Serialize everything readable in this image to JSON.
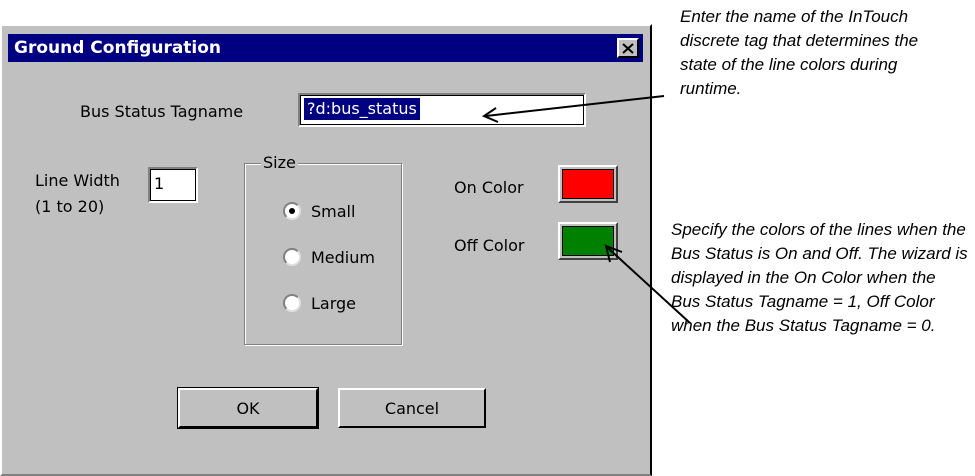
{
  "dialog": {
    "title": "Ground Configuration",
    "close_icon": "close-icon",
    "bus_status_label": "Bus Status Tagname",
    "bus_status_value": "?d:bus_status",
    "line_width_label": "Line Width",
    "line_width_range": "(1 to 20)",
    "line_width_value": "1",
    "size_group_title": "Size",
    "size_options": [
      {
        "label": "Small",
        "selected": true
      },
      {
        "label": "Medium",
        "selected": false
      },
      {
        "label": "Large",
        "selected": false
      }
    ],
    "on_color_label": "On Color",
    "on_color": "#ff0000",
    "off_color_label": "Off Color",
    "off_color": "#008000",
    "ok_label": "OK",
    "cancel_label": "Cancel"
  },
  "annotations": {
    "tagname_note": "Enter the name of the InTouch discrete tag that determines the state of the line colors during runtime.",
    "color_note": "Specify the colors of the lines when the Bus Status is On and Off. The wizard is displayed in the On Color when the Bus Status Tagname = 1, Off Color when the Bus Status Tagname = 0."
  }
}
